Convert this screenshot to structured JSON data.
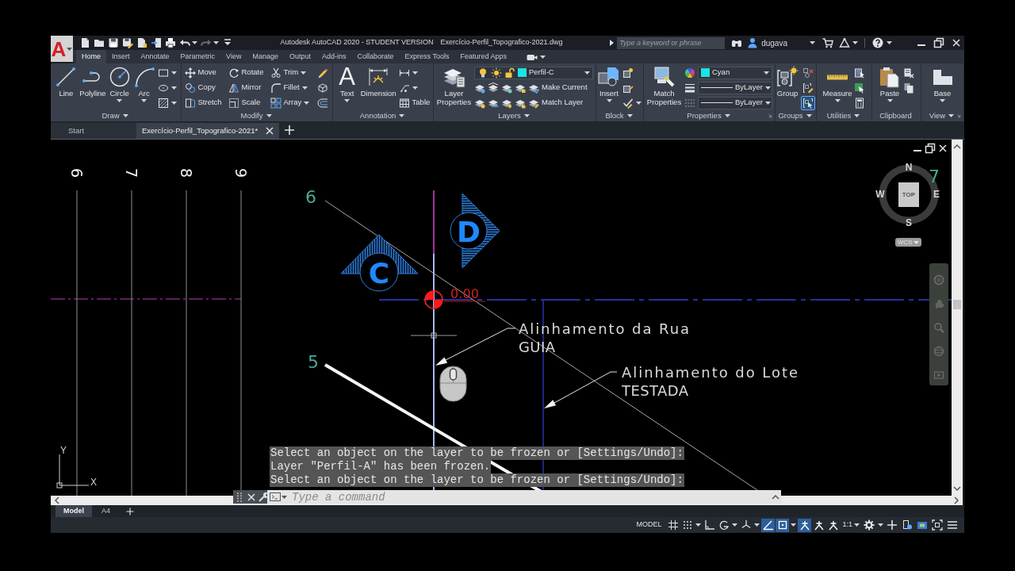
{
  "app": {
    "logo": "A",
    "title": "Autodesk AutoCAD 2020 - STUDENT VERSION",
    "file": "Exercício-Perfil_Topografico-2021.dwg"
  },
  "quick_access": [
    {
      "dropdown": false,
      "disabled": false
    },
    {
      "dropdown": false,
      "disabled": false
    },
    {
      "dropdown": false,
      "disabled": false
    },
    {
      "dropdown": false,
      "disabled": false
    },
    {
      "dropdown": false,
      "disabled": false
    },
    {
      "dropdown": false,
      "disabled": false
    },
    {
      "dropdown": false,
      "disabled": false
    },
    {
      "dropdown": true,
      "disabled": false
    },
    {
      "dropdown": true,
      "disabled": true
    },
    {
      "dropdown": false,
      "disabled": false
    }
  ],
  "search": {
    "placeholder": "Type a keyword or phrase"
  },
  "user": {
    "name": "dugava"
  },
  "ribbon_tabs": [
    {
      "label": "Home",
      "selected": true
    },
    {
      "label": "Insert",
      "selected": false
    },
    {
      "label": "Annotate",
      "selected": false
    },
    {
      "label": "Parametric",
      "selected": false
    },
    {
      "label": "View",
      "selected": false
    },
    {
      "label": "Manage",
      "selected": false
    },
    {
      "label": "Output",
      "selected": false
    },
    {
      "label": "Add-ins",
      "selected": false
    },
    {
      "label": "Collaborate",
      "selected": false
    },
    {
      "label": "Express Tools",
      "selected": false
    },
    {
      "label": "Featured Apps",
      "selected": false
    }
  ],
  "ribbon_panels": [
    {
      "title": "Draw",
      "dropdown": true,
      "launcher": false,
      "large": [
        {
          "label": "Line",
          "dropdown": false
        },
        {
          "label": "Polyline",
          "dropdown": false
        },
        {
          "label": "Circle",
          "dropdown": true
        },
        {
          "label": "Arc",
          "dropdown": true
        }
      ],
      "rows": [
        [
          {
            "kind": "icon",
            "dropdown": true
          }
        ],
        [
          {
            "kind": "icon",
            "dropdown": true
          }
        ],
        [
          {
            "kind": "icon",
            "dropdown": true
          }
        ]
      ]
    },
    {
      "title": "Modify",
      "dropdown": true,
      "launcher": false,
      "rows": [
        [
          {
            "kind": "button",
            "label": "Move",
            "dropdown": false
          },
          {
            "kind": "button",
            "label": "Rotate",
            "dropdown": false
          },
          {
            "kind": "button",
            "label": "Trim",
            "dropdown": true
          },
          {
            "kind": "icon",
            "dropdown": false
          }
        ],
        [
          {
            "kind": "button",
            "label": "Copy",
            "dropdown": false
          },
          {
            "kind": "button",
            "label": "Mirror",
            "dropdown": false
          },
          {
            "kind": "button",
            "label": "Fillet",
            "dropdown": true
          },
          {
            "kind": "icon",
            "dropdown": false
          }
        ],
        [
          {
            "kind": "button",
            "label": "Stretch",
            "dropdown": false
          },
          {
            "kind": "button",
            "label": "Scale",
            "dropdown": false
          },
          {
            "kind": "button",
            "label": "Array",
            "dropdown": true
          },
          {
            "kind": "icon",
            "dropdown": false
          }
        ]
      ]
    },
    {
      "title": "Annotation",
      "dropdown": true,
      "launcher": false,
      "large": [
        {
          "label": "Text",
          "glyph": "A",
          "dropdown": true
        },
        {
          "label": "Dimension",
          "dropdown": false
        }
      ],
      "rows": [
        [
          {
            "kind": "icon",
            "dropdown": true
          }
        ],
        [
          {
            "kind": "icon",
            "dropdown": true
          }
        ],
        [
          {
            "kind": "button",
            "label": "Table",
            "dropdown": false
          }
        ]
      ]
    },
    {
      "title": "Layers",
      "dropdown": true,
      "launcher": false,
      "large": [
        {
          "label": "Layer Properties",
          "dropdown": false
        }
      ],
      "rows": [
        [
          {
            "kind": "combo",
            "value": "Perfil-C",
            "color": "#1de3e6",
            "on": true,
            "frozen": false,
            "locked": false
          }
        ],
        [
          {
            "kind": "icon",
            "dropdown": false
          },
          {
            "kind": "icon",
            "dropdown": false
          },
          {
            "kind": "icon",
            "dropdown": false
          },
          {
            "kind": "icon",
            "dropdown": false
          },
          {
            "kind": "button",
            "label": "Make Current",
            "dropdown": false
          }
        ],
        [
          {
            "kind": "icon",
            "dropdown": false
          },
          {
            "kind": "icon",
            "dropdown": false
          },
          {
            "kind": "icon",
            "dropdown": false
          },
          {
            "kind": "icon",
            "dropdown": false
          },
          {
            "kind": "button",
            "label": "Match Layer",
            "dropdown": false
          }
        ]
      ]
    },
    {
      "title": "Block",
      "dropdown": true,
      "launcher": false,
      "large": [
        {
          "label": "Insert",
          "dropdown": true
        }
      ],
      "rows": [
        [
          {
            "kind": "icon",
            "dropdown": false
          }
        ],
        [
          {
            "kind": "icon",
            "dropdown": false
          }
        ],
        [
          {
            "kind": "icon",
            "dropdown": true
          }
        ]
      ]
    },
    {
      "title": "Properties",
      "dropdown": true,
      "launcher": true,
      "large": [
        {
          "label": "Match Properties",
          "dropdown": false
        }
      ],
      "rows": [
        [
          {
            "kind": "icon",
            "dropdown": false
          },
          {
            "kind": "combo",
            "value": "Cyan",
            "color": "#1de3e6"
          }
        ],
        [
          {
            "kind": "icon",
            "dropdown": false
          },
          {
            "kind": "combo",
            "value": "ByLayer"
          }
        ],
        [
          {
            "kind": "icon",
            "dropdown": false
          },
          {
            "kind": "combo",
            "value": "ByLayer"
          }
        ]
      ]
    },
    {
      "title": "Groups",
      "dropdown": true,
      "launcher": false,
      "large": [
        {
          "label": "Group",
          "dropdown": false
        }
      ],
      "rows": [
        [
          {
            "kind": "icon",
            "dropdown": false,
            "on": false
          }
        ],
        [
          {
            "kind": "icon",
            "dropdown": false,
            "on": false
          }
        ],
        [
          {
            "kind": "icon",
            "dropdown": false,
            "on": true
          }
        ]
      ]
    },
    {
      "title": "Utilities",
      "dropdown": true,
      "launcher": false,
      "large": [
        {
          "label": "Measure",
          "dropdown": true
        }
      ],
      "rows": [
        [
          {
            "kind": "icon",
            "dropdown": false
          }
        ],
        [
          {
            "kind": "icon",
            "dropdown": false
          }
        ],
        [
          {
            "kind": "icon",
            "dropdown": false
          }
        ]
      ]
    },
    {
      "title": "Clipboard",
      "dropdown": false,
      "launcher": false,
      "large": [
        {
          "label": "Paste",
          "dropdown": true
        }
      ],
      "rows": [
        [
          {
            "kind": "icon",
            "dropdown": false
          }
        ],
        [
          {
            "kind": "icon",
            "dropdown": false
          }
        ]
      ]
    },
    {
      "title": "View",
      "dropdown": true,
      "launcher": true,
      "large": [
        {
          "label": "Base",
          "dropdown": true
        }
      ]
    }
  ],
  "file_tabs": [
    {
      "label": "Start",
      "selected": false,
      "closable": false
    },
    {
      "label": "Exercício-Perfil_Topografico-2021*",
      "selected": true,
      "closable": true
    }
  ],
  "drawing": {
    "station_labels": [
      "6",
      "7",
      "8",
      "9"
    ],
    "point_labels": [
      "6",
      "5",
      "7"
    ],
    "markers": [
      {
        "letter": "C"
      },
      {
        "letter": "D"
      }
    ],
    "origin_reading": "0.00",
    "leaders": [
      {
        "lines": [
          "Alinhamento da Rua",
          "GUIA"
        ]
      },
      {
        "lines": [
          "Alinhamento do Lote",
          "TESTADA"
        ]
      }
    ],
    "ucs_axes": [
      "X",
      "Y"
    ]
  },
  "viewcube": {
    "compass": [
      "N",
      "E",
      "S",
      "W"
    ],
    "face": "TOP",
    "ucs_menu": "WCS"
  },
  "command_line": {
    "history": [
      "Select an object on the layer to be frozen or [Settings/Undo]:",
      "Layer \"Perfil-A\" has been frozen.",
      "Select an object on the layer to be frozen or [Settings/Undo]:"
    ],
    "placeholder": "Type a command"
  },
  "layout_tabs": [
    {
      "label": "Model",
      "selected": true
    },
    {
      "label": "A4",
      "selected": false
    }
  ],
  "status_bar": {
    "space": "MODEL",
    "toggles": [
      {
        "on": false,
        "dropdown": false
      },
      {
        "on": false,
        "dropdown": true
      },
      {
        "on": false,
        "dropdown": false
      },
      {
        "on": false,
        "dropdown": true
      },
      {
        "on": false,
        "dropdown": true
      },
      {
        "on": true,
        "dropdown": false
      },
      {
        "on": true,
        "dropdown": true
      },
      {
        "on": true,
        "dropdown": false
      },
      {
        "on": false,
        "dropdown": false
      },
      {
        "on": false,
        "dropdown": false
      }
    ],
    "scale": "1:1",
    "tools": [
      {
        "dropdown": true
      },
      {
        "dropdown": false
      },
      {
        "dropdown": false
      },
      {
        "dropdown": false
      },
      {
        "dropdown": false
      },
      {
        "dropdown": false
      }
    ]
  }
}
